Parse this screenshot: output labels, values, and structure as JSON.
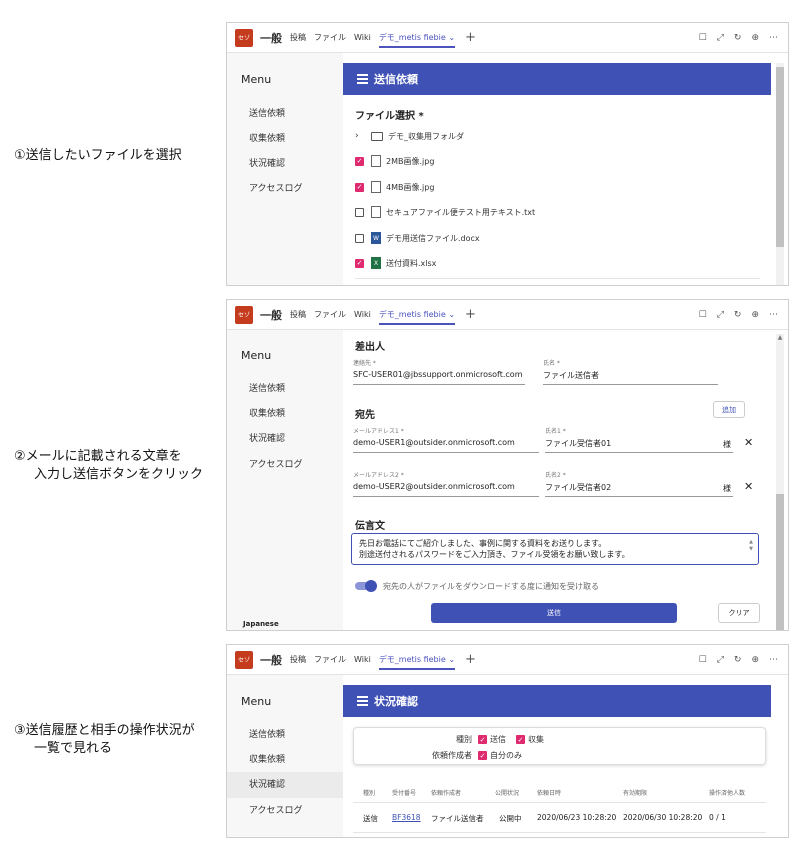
{
  "captions": [
    "①送信したいファイルを選択",
    "②メールに記載される文章を",
    "入力し送信ボタンをクリック",
    "③送信履歴と相手の操作状況が",
    "一覧で見れる"
  ],
  "app": {
    "badge": "セゾ",
    "channel": "一般",
    "tabs": [
      "投稿",
      "ファイル",
      "Wiki"
    ],
    "active_tab": "デモ_metis fiebie",
    "plus": "+",
    "menu_title": "Menu",
    "menu_items": [
      "送信依頼",
      "収集依頼",
      "状況確認",
      "アクセスログ"
    ],
    "language": "Japanese"
  },
  "panel1": {
    "header": "送信依頼",
    "section_title": "ファイル選択 *",
    "folder": "デモ_収集用フォルダ",
    "files": [
      {
        "name": "2MB画像.jpg",
        "checked": true,
        "icon": "image-file-icon"
      },
      {
        "name": "4MB画像.jpg",
        "checked": true,
        "icon": "image-file-icon"
      },
      {
        "name": "セキュアファイル便テスト用テキスト.txt",
        "checked": false,
        "icon": "text-file-icon"
      },
      {
        "name": "デモ用送信ファイル.docx",
        "checked": false,
        "icon": "word-file-icon"
      },
      {
        "name": "送付資料.xlsx",
        "checked": true,
        "icon": "excel-file-icon"
      }
    ]
  },
  "panel2": {
    "sender_title": "差出人",
    "contact_label": "連絡先 *",
    "contact_value": "SFC-USER01@jbssupport.onmicrosoft.com",
    "name_label": "氏名 *",
    "name_value": "ファイル送信者",
    "recipient_title": "宛先",
    "add_button": "追加",
    "recipients": [
      {
        "email_label": "メールアドレス1 *",
        "email": "demo-USER1@outsider.onmicrosoft.com",
        "name_label": "氏名1 *",
        "name": "ファイル受信者01",
        "suffix": "様"
      },
      {
        "email_label": "メールアドレス2 *",
        "email": "demo-USER2@outsider.onmicrosoft.com",
        "name_label": "氏名2 *",
        "name": "ファイル受信者02",
        "suffix": "様"
      }
    ],
    "message_title": "伝言文",
    "message_line1": "先日お電話にてご紹介しました、事例に関する資料をお送りします。",
    "message_line2": "別途送付されるパスワードをご入力頂き、ファイル受領をお願い致します。",
    "toggle_label": "宛先の人がファイルをダウンロードする度に通知を受け取る",
    "send_button": "送信",
    "clear_button": "クリア"
  },
  "panel3": {
    "header": "状況確認",
    "type_label": "種別",
    "type_options": [
      "送信",
      "収集"
    ],
    "creator_label": "依頼作成者",
    "creator_option": "自分のみ",
    "columns": [
      "種別",
      "受付番号",
      "依頼作成者",
      "公開状況",
      "依頼日時",
      "有効期限",
      "操作済他人数"
    ],
    "rows": [
      {
        "type": "送信",
        "id": "BF3618",
        "creator": "ファイル送信者",
        "status": "公開中",
        "requested": "2020/06/23 10:28:20",
        "expires": "2020/06/30 10:28:20",
        "count": "0 / 1"
      }
    ]
  },
  "colors": {
    "primary": "#3f51b5",
    "checkbox": "#e02a6f",
    "badge": "#c43b1d",
    "tab_active": "#4b53bc"
  }
}
